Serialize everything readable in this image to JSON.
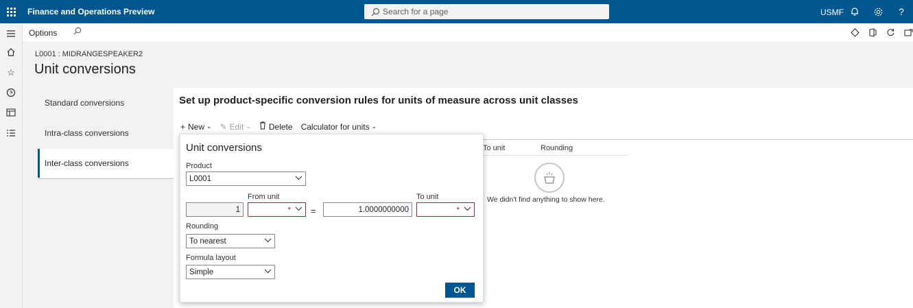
{
  "topbar": {
    "app_title": "Finance and Operations Preview",
    "search_placeholder": "Search for a page",
    "company": "USMF",
    "icons": [
      "bell-icon",
      "gear-icon",
      "help-icon"
    ]
  },
  "leftnav": {
    "icons": [
      "hamburger-icon",
      "home-icon",
      "star-icon",
      "clock-icon",
      "workspace-icon",
      "list-icon"
    ]
  },
  "actionbar": {
    "options_label": "Options"
  },
  "header": {
    "caption": "L0001 : MIDRANGESPEAKER2",
    "title": "Unit conversions"
  },
  "subnav": {
    "items": [
      {
        "label": "Standard conversions"
      },
      {
        "label": "Intra-class conversions"
      },
      {
        "label": "Inter-class conversions"
      }
    ]
  },
  "main": {
    "heading": "Set up product-specific conversion rules for units of measure across unit classes",
    "toolbar": {
      "new_label": "New",
      "edit_label": "Edit",
      "delete_label": "Delete",
      "calculator_label": "Calculator for units"
    },
    "grid": {
      "columns": [
        "To unit",
        "Rounding"
      ],
      "empty_message": "We didn't find anything to show here."
    }
  },
  "dialog": {
    "title": "Unit conversions",
    "product_label": "Product",
    "product_value": "L0001",
    "from_unit_label": "From unit",
    "to_unit_label": "To unit",
    "from_quantity": "1",
    "equals": "=",
    "factor_value": "1.0000000000",
    "required_marker": "*",
    "rounding_label": "Rounding",
    "rounding_value": "To nearest",
    "formula_label": "Formula layout",
    "formula_value": "Simple",
    "ok_label": "OK"
  },
  "colors": {
    "brand": "#00578f",
    "required": "#a4262c"
  }
}
